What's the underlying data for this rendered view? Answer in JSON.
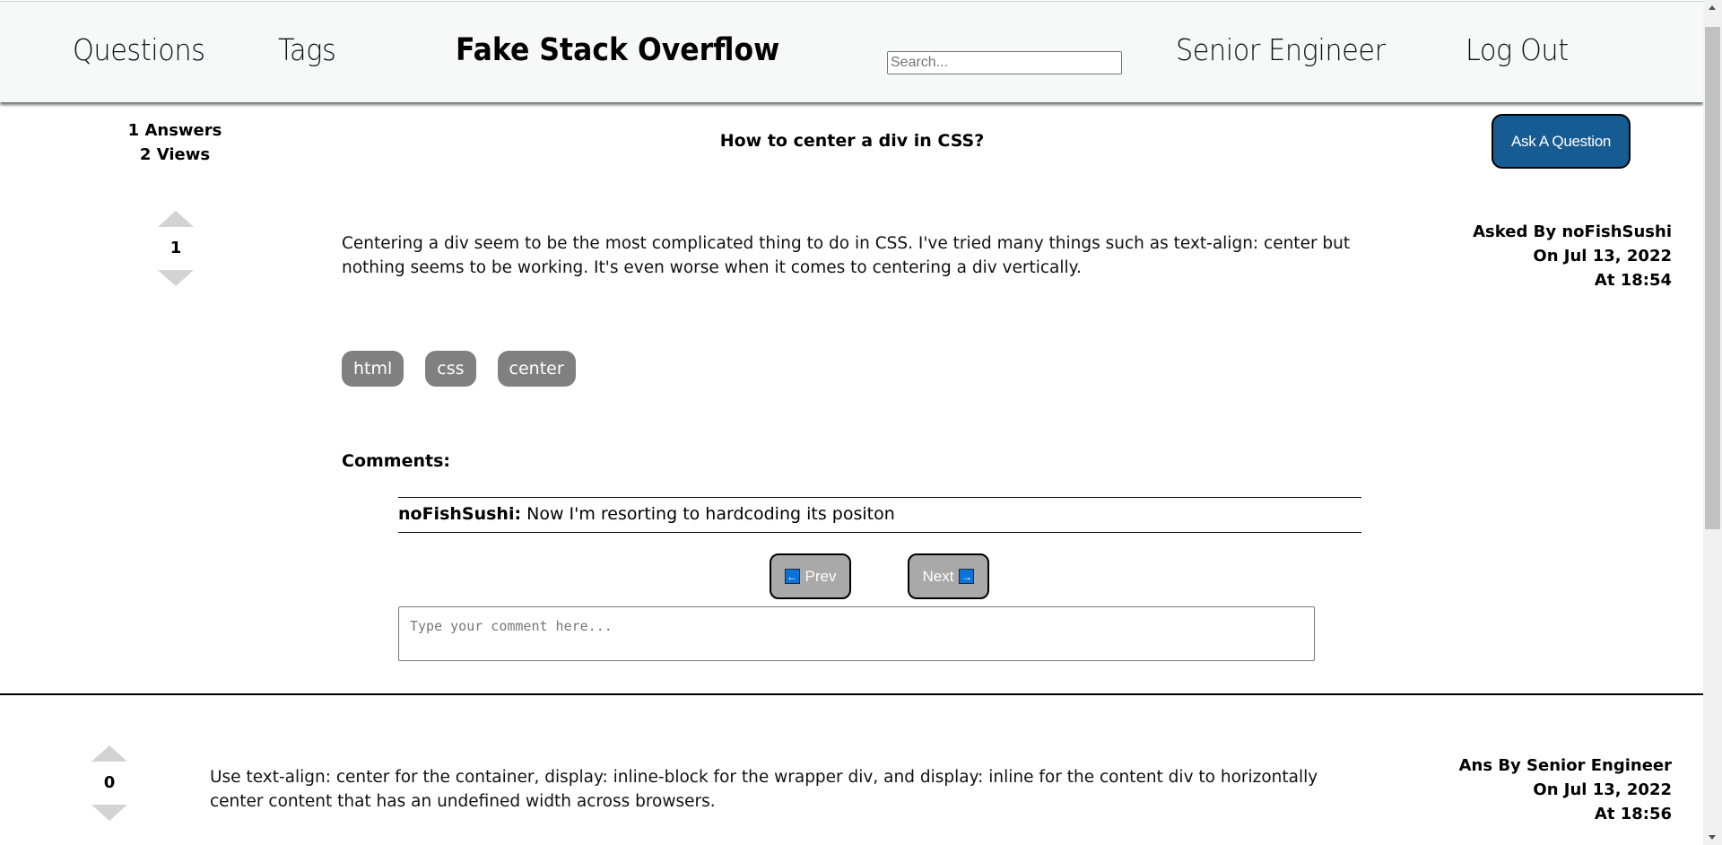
{
  "header": {
    "nav_questions": "Questions",
    "nav_tags": "Tags",
    "site_title": "Fake Stack Overflow",
    "search_placeholder": "Search...",
    "search_value": "",
    "user_name": "Senior Engineer",
    "logout": "Log Out"
  },
  "question": {
    "answers_count": "1 Answers",
    "views_count": "2 Views",
    "title": "How to center a div in CSS?",
    "ask_button": "Ask A Question",
    "votes": "1",
    "body": "Centering a div seem to be the most complicated thing to do in CSS. I've tried many things such as text-align: center but nothing seems to be working. It's even worse when it comes to centering a div vertically.",
    "asked_by": "Asked By noFishSushi",
    "asked_on": "On Jul 13, 2022",
    "asked_at": "At 18:54",
    "tags": [
      "html",
      "css",
      "center"
    ],
    "comments_label": "Comments:",
    "comments": [
      {
        "author": "noFishSushi:",
        "text": " Now I'm resorting to hardcoding its positon"
      }
    ],
    "prev_label": "Prev",
    "next_label": "Next",
    "prev_icon": "←",
    "next_icon": "→",
    "comment_placeholder": "Type your comment here..."
  },
  "answers": [
    {
      "votes": "0",
      "body": "Use text-align: center for the container, display: inline-block for the wrapper div, and display: inline for the content div to horizontally center content that has an undefined width across browsers.",
      "ans_by": "Ans By Senior Engineer",
      "ans_on": "On Jul 13, 2022",
      "ans_at": "At 18:56"
    }
  ],
  "colors": {
    "ask_button_bg": "#175b93",
    "tag_bg": "#808080",
    "page_button_bg": "#a9a9a9",
    "vote_arrow": "#d3d3d3",
    "header_bg": "#f7f8f8"
  }
}
